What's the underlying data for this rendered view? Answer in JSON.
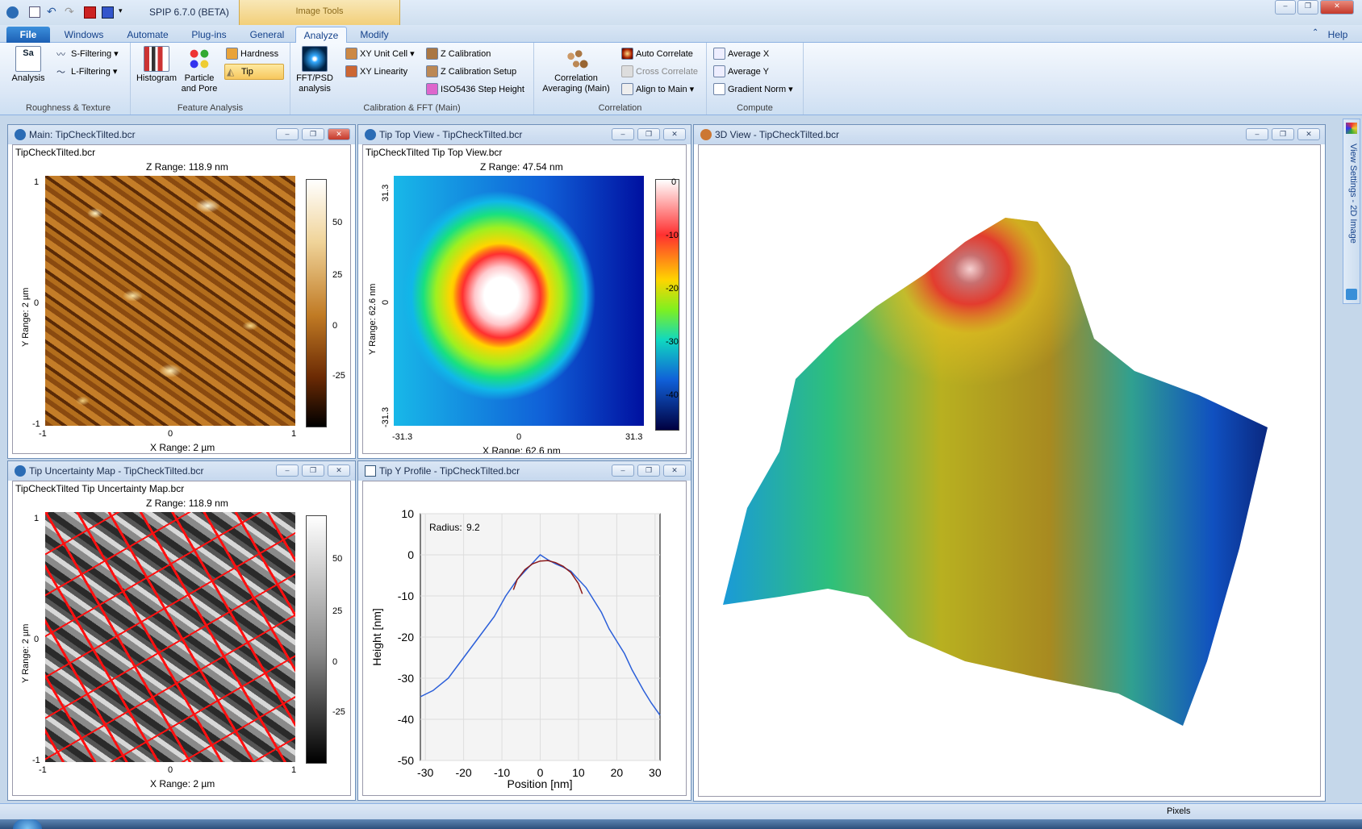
{
  "app": {
    "title": "SPIP 6.7.0 (BETA)",
    "context_tab": "Image Tools"
  },
  "tabs": {
    "file": "File",
    "windows": "Windows",
    "automate": "Automate",
    "plugins": "Plug-ins",
    "general": "General",
    "analyze": "Analyze",
    "modify": "Modify",
    "help": "Help"
  },
  "ribbon": {
    "roughness": {
      "label": "Roughness & Texture",
      "sa": "Sa",
      "analysis": "Analysis",
      "sfilter": "S-Filtering",
      "lfilter": "L-Filtering"
    },
    "feature": {
      "label": "Feature Analysis",
      "histogram": "Histogram",
      "particle1": "Particle",
      "particle2": "and Pore",
      "hardness": "Hardness",
      "tip": "Tip"
    },
    "calib": {
      "label": "Calibration & FFT (Main)",
      "fft1": "FFT/PSD",
      "fft2": "analysis",
      "xyunit": "XY Unit Cell",
      "xylin": "XY Linearity",
      "zcal": "Z Calibration",
      "zcalsetup": "Z Calibration Setup",
      "iso": "ISO5436 Step Height"
    },
    "correlation": {
      "label": "Correlation",
      "corr1": "Correlation",
      "corr2": "Averaging (Main)",
      "auto": "Auto Correlate",
      "cross": "Cross Correlate",
      "align": "Align to Main"
    },
    "compute": {
      "label": "Compute",
      "avgx": "Average X",
      "avgy": "Average Y",
      "grad": "Gradient Norm"
    }
  },
  "windows": {
    "main": {
      "title": "Main: TipCheckTilted.bcr",
      "file": "TipCheckTilted.bcr",
      "zrange": "Z Range:  118.9 nm",
      "xrange": "X Range: 2 µm",
      "yrange": "Y Range: 2 µm",
      "xticks": [
        "-1",
        "0",
        "1"
      ],
      "yticks": [
        "1",
        "0",
        "-1"
      ],
      "cticks": [
        "50",
        "25",
        "0",
        "-25"
      ]
    },
    "tiptop": {
      "title": "Tip Top View - TipCheckTilted.bcr",
      "file": "TipCheckTilted Tip Top View.bcr",
      "zrange": "Z Range:  47.54 nm",
      "xrange": "X Range:  62.6 nm",
      "yrange": "Y Range:  62.6 nm",
      "xticks": [
        "-31.3",
        "0",
        "31.3"
      ],
      "yticks": [
        "31.3",
        "0",
        "-31.3"
      ],
      "cticks": [
        "0",
        "-10",
        "-20",
        "-30",
        "-40"
      ]
    },
    "uncert": {
      "title": "Tip Uncertainty Map - TipCheckTilted.bcr",
      "file": "TipCheckTilted Tip Uncertainty Map.bcr",
      "zrange": "Z Range:  118.9 nm",
      "xrange": "X Range: 2 µm",
      "yrange": "Y Range: 2 µm",
      "xticks": [
        "-1",
        "0",
        "1"
      ],
      "yticks": [
        "1",
        "0",
        "-1"
      ],
      "cticks": [
        "50",
        "25",
        "0",
        "-25"
      ]
    },
    "profile": {
      "title": "Tip Y Profile - TipCheckTilted.bcr",
      "radius_label": "Radius:",
      "radius_value": "9.2"
    },
    "view3d": {
      "title": "3D View - TipCheckTilted.bcr"
    }
  },
  "side": {
    "label": "View Settings - 2D Image"
  },
  "status": {
    "units": "Pixels"
  },
  "chart_data": {
    "type": "line",
    "xlabel": "Position [nm]",
    "ylabel": "Height [nm]",
    "xlim": [
      -31.3,
      31.3
    ],
    "ylim": [
      -50,
      10
    ],
    "xticks": [
      -30,
      -20,
      -10,
      0,
      10,
      20,
      30
    ],
    "yticks": [
      10,
      0,
      -10,
      -20,
      -30,
      -40,
      -50
    ],
    "series": [
      {
        "color": "#2b5fd9",
        "x": [
          -31.3,
          -28,
          -24,
          -20,
          -16,
          -12,
          -9,
          -6,
          -4,
          -2,
          0,
          2,
          4,
          6,
          8,
          10,
          12,
          14,
          16,
          18,
          20,
          22,
          24,
          27,
          29,
          31.3
        ],
        "y": [
          -34.5,
          -33,
          -30,
          -25,
          -20,
          -15,
          -10,
          -6,
          -4,
          -2,
          0,
          -1.2,
          -2.2,
          -3,
          -4,
          -6,
          -8,
          -11,
          -14,
          -18,
          -21,
          -24,
          -28,
          -33,
          -36,
          -39
        ]
      },
      {
        "color": "#8b1a1a",
        "x": [
          -7,
          -6,
          -4,
          -2,
          0,
          2,
          4,
          6,
          8,
          10,
          11
        ],
        "y": [
          -8.5,
          -6,
          -3.6,
          -2.2,
          -1.5,
          -1.4,
          -1.9,
          -2.8,
          -4.3,
          -7,
          -9.5
        ]
      }
    ]
  }
}
